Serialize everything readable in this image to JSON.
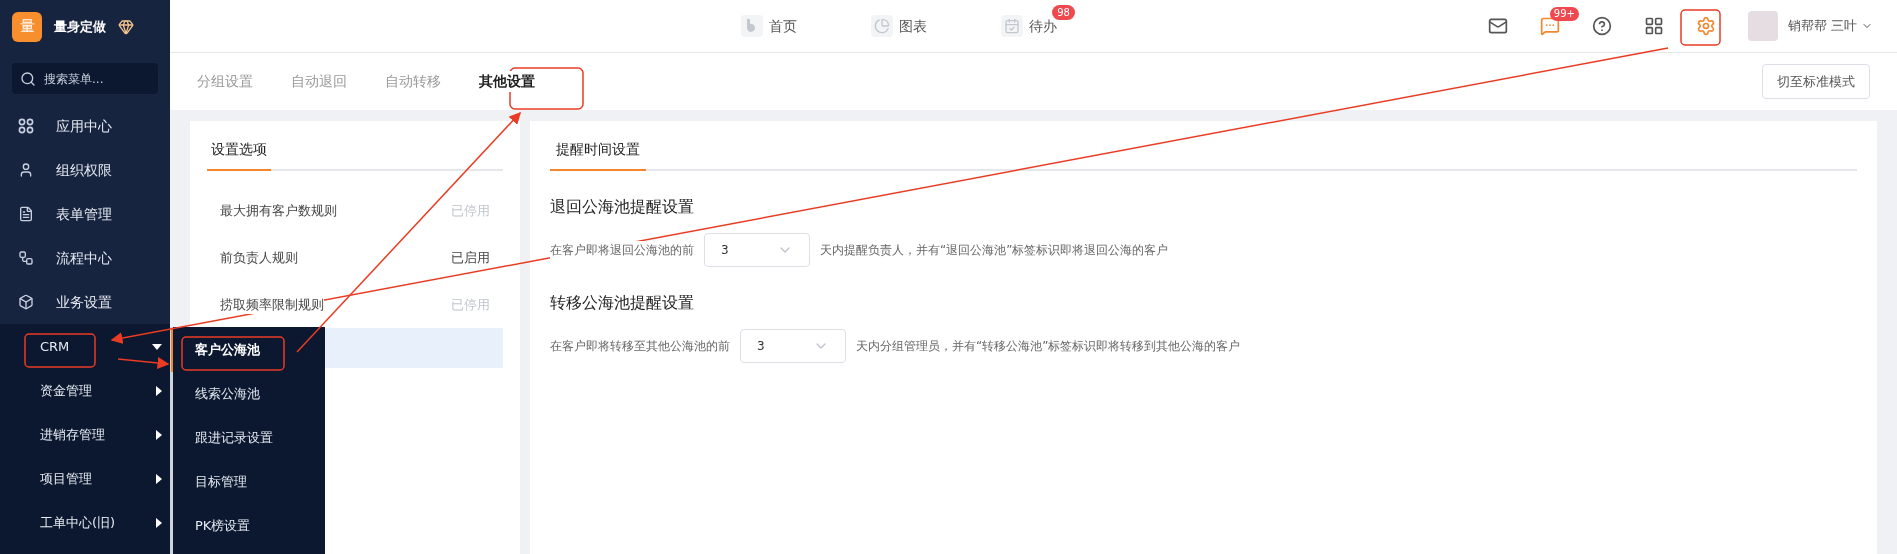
{
  "sidebar": {
    "logo": "量",
    "title": "量身定做",
    "search": {
      "placeholder": "搜索菜单..."
    },
    "items": [
      {
        "label": "应用中心",
        "kind": "apps"
      },
      {
        "label": "组织权限",
        "kind": "user"
      },
      {
        "label": "表单管理",
        "kind": "form"
      },
      {
        "label": "流程中心",
        "kind": "flow"
      },
      {
        "label": "业务设置",
        "kind": "box"
      }
    ],
    "submenu": [
      {
        "label": "CRM",
        "expanded": true
      },
      {
        "label": "资金管理",
        "expanded": false
      },
      {
        "label": "进销存管理",
        "expanded": false
      },
      {
        "label": "项目管理",
        "expanded": false
      },
      {
        "label": "工单中心(旧)",
        "expanded": false
      }
    ],
    "flyout": [
      {
        "label": "客户公海池",
        "selected": true
      },
      {
        "label": "线索公海池",
        "selected": false
      },
      {
        "label": "跟进记录设置",
        "selected": false
      },
      {
        "label": "目标管理",
        "selected": false
      },
      {
        "label": "PK榜设置",
        "selected": false
      }
    ]
  },
  "topbar": {
    "nav": [
      {
        "label": "首页",
        "kind": "home"
      },
      {
        "label": "图表",
        "kind": "chart"
      },
      {
        "label": "待办",
        "kind": "todo",
        "badge": "98"
      }
    ],
    "tools": [
      {
        "kind": "mail"
      },
      {
        "kind": "chat",
        "badge": "99+"
      },
      {
        "kind": "help"
      },
      {
        "kind": "grid"
      },
      {
        "kind": "settings"
      }
    ],
    "user": "销帮帮 三叶"
  },
  "tabs": [
    {
      "label": "分组设置",
      "selected": false
    },
    {
      "label": "自动退回",
      "selected": false
    },
    {
      "label": "自动转移",
      "selected": false
    },
    {
      "label": "其他设置",
      "selected": true
    }
  ],
  "mode_button": "切至标准模式",
  "options_panel": {
    "title": "设置选项",
    "items": [
      {
        "label": "最大拥有客户数规则",
        "status": "已停用",
        "enabled": false
      },
      {
        "label": "前负责人规则",
        "status": "已启用",
        "enabled": true
      },
      {
        "label": "捞取频率限制规则",
        "status": "已停用",
        "enabled": false
      }
    ]
  },
  "reminder_panel": {
    "tab": "提醒时间设置",
    "sections": [
      {
        "heading": "退回公海池提醒设置",
        "before": "在客户即将退回公海池的前",
        "value": "3",
        "after": "天内提醒负责人，并有“退回公海池”标签标识即将退回公海的客户"
      },
      {
        "heading": "转移公海池提醒设置",
        "before": "在客户即将转移至其他公海池的前",
        "value": "3",
        "after": "天内分组管理员，并有“转移公海池”标签标识即将转移到其他公海的客户"
      }
    ]
  }
}
